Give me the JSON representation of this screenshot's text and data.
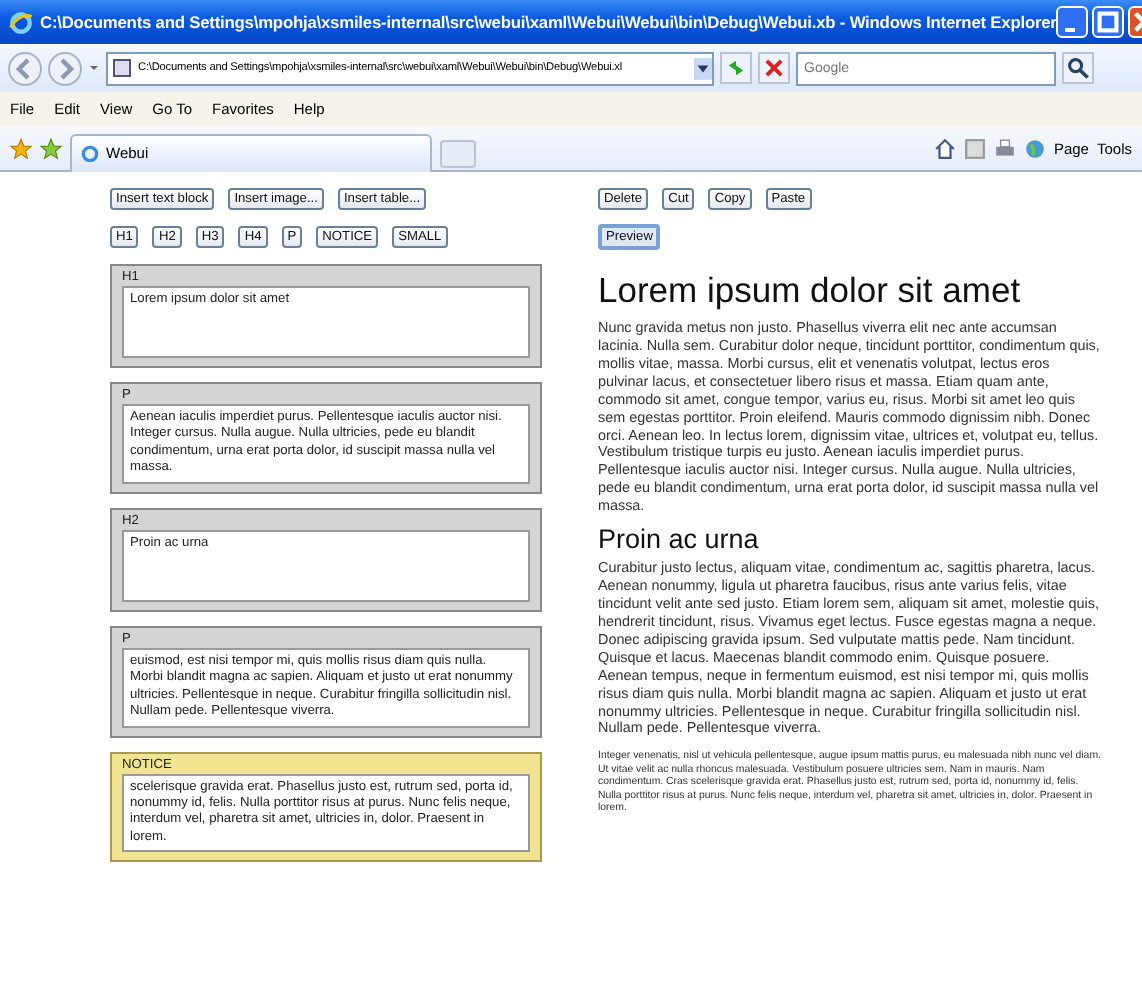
{
  "window": {
    "title": "C:\\Documents and Settings\\mpohja\\xsmiles-internal\\src\\webui\\xaml\\Webui\\Webui\\bin\\Debug\\Webui.xb - Windows Internet Explorer"
  },
  "address_bar": {
    "url": "C:\\Documents and Settings\\mpohja\\xsmiles-internal\\src\\webui\\xaml\\Webui\\Webui\\bin\\Debug\\Webui.xl"
  },
  "search": {
    "placeholder": "Google"
  },
  "menu": [
    "File",
    "Edit",
    "View",
    "Go To",
    "Favorites",
    "Help"
  ],
  "tab": {
    "title": "Webui"
  },
  "command_bar": [
    "Page",
    "Tools"
  ],
  "insert_buttons": [
    "Insert text block",
    "Insert image...",
    "Insert table..."
  ],
  "style_buttons": [
    "H1",
    "H2",
    "H3",
    "H4",
    "P",
    "NOTICE",
    "SMALL"
  ],
  "blocks": [
    {
      "kind": "normal",
      "label": "H1",
      "text": "Lorem ipsum dolor sit amet",
      "tall": true
    },
    {
      "kind": "normal",
      "label": "P",
      "text": "Aenean iaculis imperdiet purus. Pellentesque iaculis auctor nisi. Integer cursus. Nulla augue. Nulla ultricies, pede eu blandit condimentum, urna erat porta dolor, id suscipit massa nulla vel massa.",
      "tall": false
    },
    {
      "kind": "normal",
      "label": "H2",
      "text": "Proin ac urna",
      "tall": true
    },
    {
      "kind": "normal",
      "label": "P",
      "text": "euismod, est nisi tempor mi, quis mollis risus diam quis nulla. Morbi blandit magna ac sapien. Aliquam et justo ut erat nonummy ultricies. Pellentesque in neque. Curabitur fringilla sollicitudin nisl. Nullam pede. Pellentesque viverra.",
      "tall": false
    },
    {
      "kind": "notice",
      "label": "NOTICE",
      "text": "scelerisque gravida erat. Phasellus justo est, rutrum sed, porta id, nonummy id, felis. Nulla porttitor risus at purus. Nunc felis neque, interdum vel, pharetra sit amet, ultricies in, dolor. Praesent in lorem.",
      "tall": false
    }
  ],
  "edit_buttons": [
    "Delete",
    "Cut",
    "Copy",
    "Paste"
  ],
  "preview_button": {
    "label": "Preview",
    "focused": true
  },
  "preview": [
    {
      "kind": "h1",
      "text": "Lorem ipsum dolor sit amet"
    },
    {
      "kind": "p",
      "text": "Nunc gravida metus non justo. Phasellus viverra elit nec ante accumsan lacinia. Nulla sem. Curabitur dolor neque, tincidunt porttitor, condimentum quis, mollis vitae, massa. Morbi cursus, elit et venenatis volutpat, lectus eros pulvinar lacus, et consectetuer libero risus et massa. Etiam quam ante, commodo sit amet, congue tempor, varius eu, risus. Morbi sit amet leo quis sem egestas porttitor. Proin eleifend. Mauris commodo dignissim nibh. Donec orci. Aenean leo. In lectus lorem, dignissim vitae, ultrices et, volutpat eu, tellus. Vestibulum tristique turpis eu justo. Aenean iaculis imperdiet purus. Pellentesque iaculis auctor nisi. Integer cursus. Nulla augue. Nulla ultricies, pede eu blandit condimentum, urna erat porta dolor, id suscipit massa nulla vel massa."
    },
    {
      "kind": "h2",
      "text": "Proin ac urna"
    },
    {
      "kind": "p",
      "text": "Curabitur justo lectus, aliquam vitae, condimentum ac, sagittis pharetra, lacus. Aenean nonummy, ligula ut pharetra faucibus, risus ante varius felis, vitae tincidunt velit ante sed justo. Etiam lorem sem, aliquam sit amet, molestie quis, hendrerit tincidunt, risus. Vivamus eget lectus. Fusce egestas magna a neque. Donec adipiscing gravida ipsum. Sed vulputate mattis pede. Nam tincidunt. Quisque et lacus. Maecenas blandit commodo enim. Quisque posuere. Aenean tempus, neque in fermentum euismod, est nisi tempor mi, quis mollis risus diam quis nulla. Morbi blandit magna ac sapien. Aliquam et justo ut erat nonummy ultricies. Pellentesque in neque. Curabitur fringilla sollicitudin nisl. Nullam pede. Pellentesque viverra."
    },
    {
      "kind": "small",
      "text": "Integer venenatis, nisl ut vehicula pellentesque, augue ipsum mattis purus, eu malesuada nibh nunc vel diam. Ut vitae velit ac nulla rhoncus malesuada. Vestibulum posuere ultricies sem. Nam in mauris. Nam condimentum. Cras scelerisque gravida erat. Phasellus justo est, rutrum sed, porta id, nonummy id, felis. Nulla porttitor risus at purus. Nunc felis neque, interdum vel, pharetra sit amet, ultricies in, dolor. Praesent in lorem."
    }
  ]
}
